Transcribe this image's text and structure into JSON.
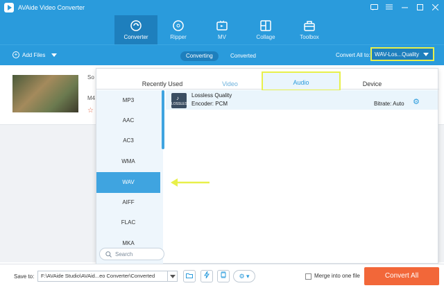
{
  "app": {
    "title": "AVAide Video Converter"
  },
  "nav": {
    "items": [
      {
        "label": "Converter",
        "active": true
      },
      {
        "label": "Ripper"
      },
      {
        "label": "MV"
      },
      {
        "label": "Collage"
      },
      {
        "label": "Toolbox"
      }
    ]
  },
  "actionbar": {
    "add_files": "Add Files",
    "tabs": [
      "Converting",
      "Converted"
    ],
    "convert_all_label": "Convert All to:",
    "format_value": "WAV-Los...Quality"
  },
  "file": {
    "name_fragment": "So",
    "format_fragment": "M4"
  },
  "panel": {
    "tabs": [
      "Recently Used",
      "Video",
      "Audio",
      "Device"
    ],
    "active_tab": "Audio",
    "categories": [
      "MP3",
      "AAC",
      "AC3",
      "WMA",
      "WAV",
      "AIFF",
      "FLAC",
      "MKA"
    ],
    "active_category": "WAV",
    "search_placeholder": "Search",
    "preset": {
      "name": "Lossless Quality",
      "encoder": "Encoder: PCM",
      "bitrate": "Bitrate: Auto",
      "icon_text": "LOSSLESS"
    }
  },
  "bottom": {
    "save_label": "Save to:",
    "save_path": "F:\\AVAide Studio\\AVAid...eo Converter\\Converted",
    "merge_label": "Merge into one file",
    "convert_all": "Convert All"
  },
  "colors": {
    "brand_blue": "#2a9bdc",
    "highlight_yellow": "#e8f04a",
    "convert_orange": "#f26739"
  }
}
